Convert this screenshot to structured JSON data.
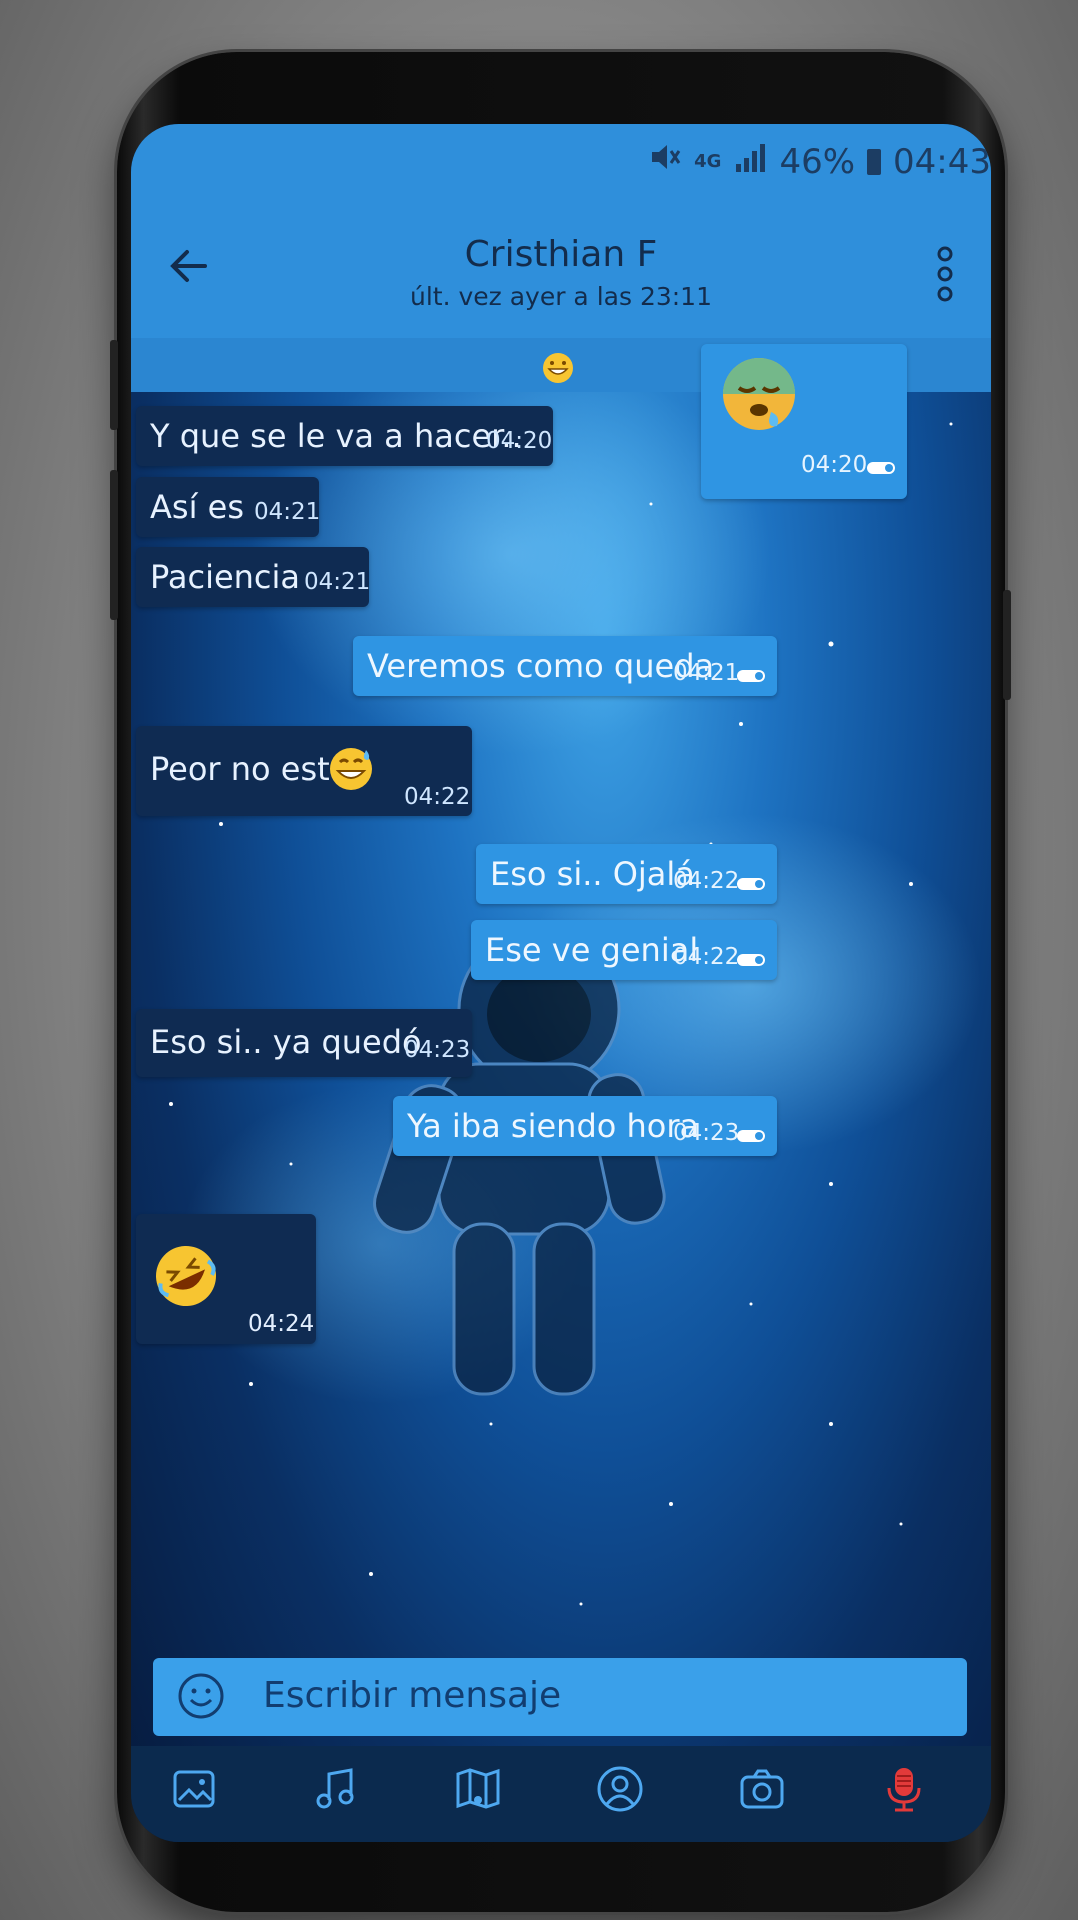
{
  "status": {
    "network": "4G",
    "battery_percent": "46%",
    "time": "04:43"
  },
  "header": {
    "contact_name": "Cristhian F",
    "last_seen": "últ. vez ayer a las 23:11",
    "icons": [
      "back-arrow-icon",
      "more-vertical-icon"
    ]
  },
  "messages": [
    {
      "dir": "out",
      "text": "",
      "emoji": "sleeping-face-emoji",
      "time": "04:20"
    },
    {
      "dir": "in",
      "text": "Y que se le va a hacer..",
      "time": "04:20"
    },
    {
      "dir": "in",
      "text": "Así es",
      "time": "04:21"
    },
    {
      "dir": "in",
      "text": "Paciencia",
      "time": "04:21"
    },
    {
      "dir": "out",
      "text": "Veremos como queda",
      "time": "04:21"
    },
    {
      "dir": "in",
      "text": "Peor no esta",
      "emoji": "grinning-sweat-emoji",
      "time": "04:22"
    },
    {
      "dir": "out",
      "text": "Eso si.. Ojalá",
      "time": "04:22"
    },
    {
      "dir": "out",
      "text": "Ese ve genial",
      "time": "04:22"
    },
    {
      "dir": "in",
      "text": "Eso si.. ya quedó",
      "time": "04:23"
    },
    {
      "dir": "out",
      "text": "Ya iba siendo hora",
      "time": "04:23"
    },
    {
      "dir": "in",
      "text": "",
      "emoji": "rolling-laughing-emoji",
      "time": "04:24"
    }
  ],
  "composer": {
    "placeholder": "Escribir mensaje"
  },
  "toolbar": {
    "icons": [
      "gallery-icon",
      "music-icon",
      "map-icon",
      "contact-icon",
      "camera-icon",
      "microphone-icon"
    ]
  },
  "colors": {
    "header": "#2f8fdb",
    "incoming_bubble": "#0f2b52",
    "outgoing_bubble": "#2f95e3",
    "toolbar": "#0b2a4e",
    "mic": "#e23a3a"
  }
}
